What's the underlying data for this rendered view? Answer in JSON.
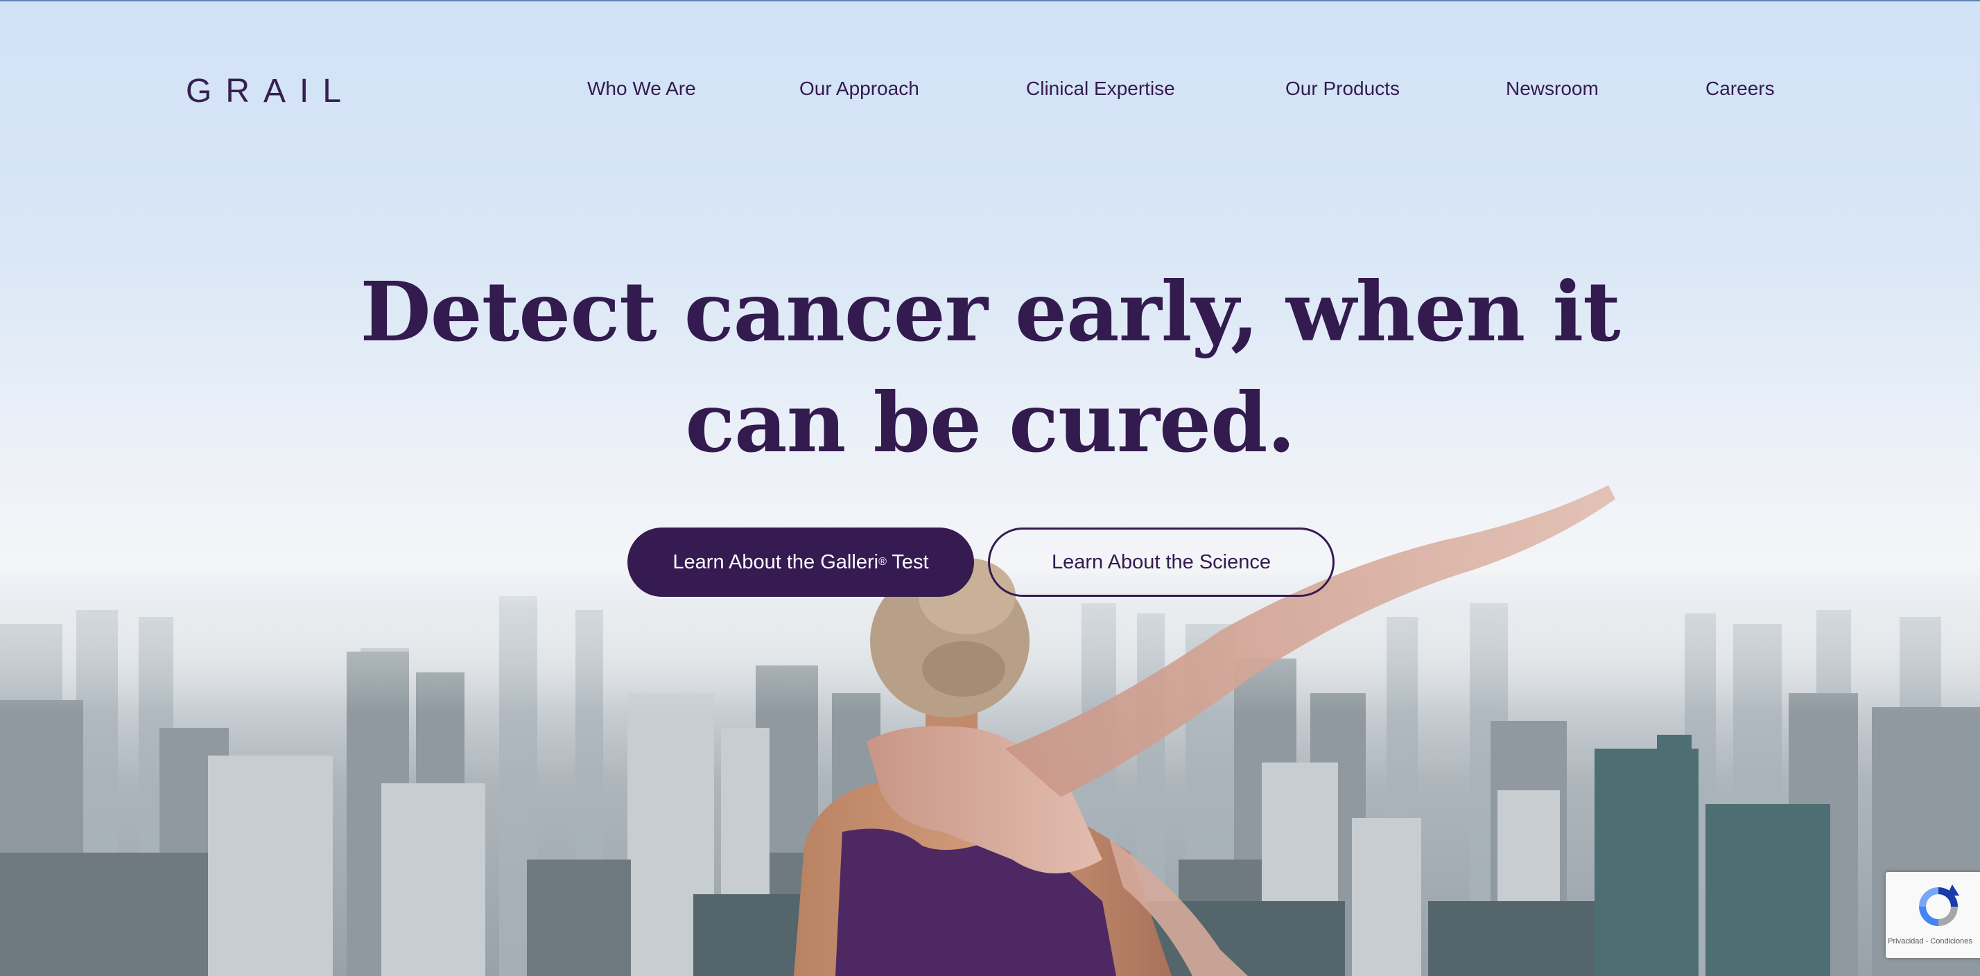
{
  "header": {
    "logo_text": "GRAIL",
    "nav": [
      {
        "label": "Who We Are"
      },
      {
        "label": "Our Approach"
      },
      {
        "label": "Clinical Expertise"
      },
      {
        "label": "Our Products"
      },
      {
        "label": "Newsroom"
      },
      {
        "label": "Careers"
      }
    ]
  },
  "hero": {
    "headline_line1": "Detect cancer early, when it",
    "headline_line2": "can be cured.",
    "primary_button": {
      "label_main": "Learn About the Galleri",
      "label_sup": "®",
      "label_end": " Test"
    },
    "secondary_button": {
      "label": "Learn About the Science"
    },
    "image_icon": "woman-scarf-city-skyline-photo"
  },
  "recaptcha": {
    "links_text": "Privacidad - Condiciones",
    "icon": "recaptcha-logo-icon"
  },
  "colors": {
    "brand_purple": "#361b52",
    "sky_blue": "#d3e3f8",
    "white": "#ffffff"
  }
}
